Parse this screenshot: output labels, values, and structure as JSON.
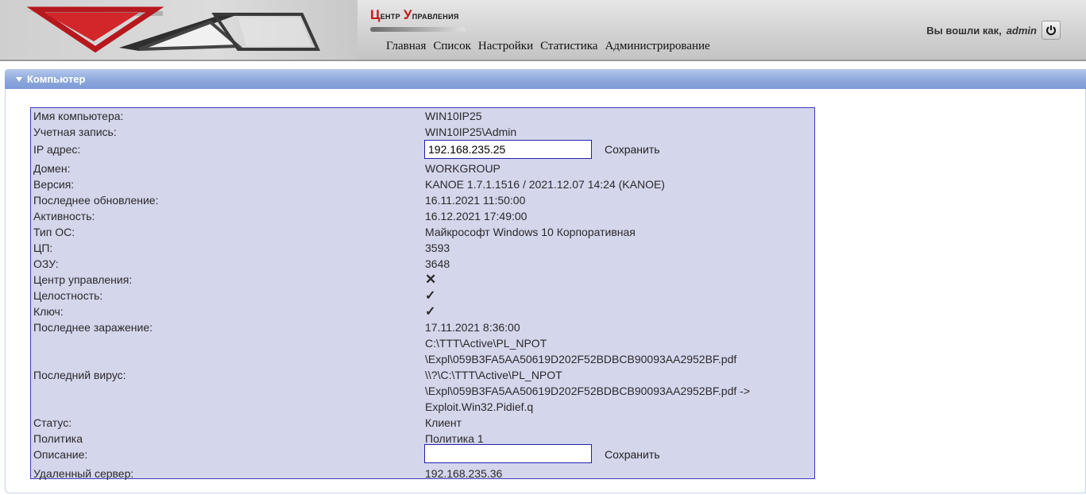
{
  "header": {
    "title_cap1": "Ц",
    "title_rest1": "ентр",
    "title_cap2": "У",
    "title_rest2": "правления",
    "nav": [
      "Главная",
      "Список",
      "Настройки",
      "Статистика",
      "Администрирование"
    ],
    "logged_in_label": "Вы вошли как,",
    "username": "admin"
  },
  "section": {
    "title": "Компьютер"
  },
  "computer": {
    "rows": [
      {
        "label": "Имя компьютера:",
        "value": "WIN10IP25"
      },
      {
        "label": "Учетная запись:",
        "value": "WIN10IP25\\Admin"
      },
      {
        "label": "IP адрес:",
        "value": "192.168.235.25",
        "save": "Сохранить"
      },
      {
        "label": "Домен:",
        "value": "WORKGROUP"
      },
      {
        "label": "Версия:",
        "value": "KANOE 1.7.1.1516 / 2021.12.07 14:24 (KANOE)"
      },
      {
        "label": "Последнее обновление:",
        "value": "16.11.2021 11:50:00"
      },
      {
        "label": "Активность:",
        "value": "16.12.2021 17:49:00"
      },
      {
        "label": "Тип ОС:",
        "value": "Майкрософт Windows 10 Корпоративная"
      },
      {
        "label": "ЦП:",
        "value": "3593"
      },
      {
        "label": "ОЗУ:",
        "value": "3648"
      },
      {
        "label": "Центр управления:",
        "value": "✕"
      },
      {
        "label": "Целостность:",
        "value": "✓"
      },
      {
        "label": "Ключ:",
        "value": "✓"
      },
      {
        "label": "Последнее заражение:",
        "value": "17.11.2021 8:36:00"
      },
      {
        "label": "",
        "value": "C:\\TTT\\Active\\PL_NPOT"
      },
      {
        "label": "",
        "value": "\\Expl\\059B3FA5AA50619D202F52BDBCB90093AA2952BF.pdf"
      },
      {
        "label": "Последний вирус:",
        "value": "\\\\?\\C:\\TTT\\Active\\PL_NPOT"
      },
      {
        "label": "",
        "value": "\\Expl\\059B3FA5AA50619D202F52BDBCB90093AA2952BF.pdf ->"
      },
      {
        "label": "",
        "value": "Exploit.Win32.Pidief.q"
      },
      {
        "label": "Статус:",
        "value": "Клиент"
      },
      {
        "label": "Политика",
        "value": "Политика 1"
      },
      {
        "label": "Описание:",
        "value": "",
        "save": "Сохранить"
      },
      {
        "label": "Удаленный сервер:",
        "value": "192.168.235.36"
      }
    ]
  },
  "colors": {
    "accent_red": "#c4161c",
    "check_green": "#2eb82e",
    "section_blue": "#8ea8de",
    "table_bg": "#d4d6ec"
  },
  "icons": {
    "logo": "company-logo",
    "power": "power-icon",
    "collapse": "triangle-down-icon"
  }
}
